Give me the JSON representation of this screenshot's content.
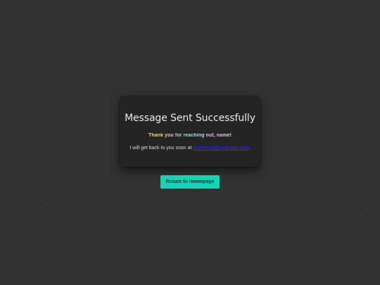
{
  "confirmation": {
    "title": "Message Sent Successfully",
    "thanks_text": "Thank you for reaching out, name!",
    "reply_prefix": "I will get back to you soon at ",
    "email_link": "youremail@example.com",
    "reply_suffix": "."
  },
  "actions": {
    "home_button_label": "Return to Homepage"
  },
  "colors": {
    "background": "#323232",
    "card": "#242424",
    "accent_button": "#12d4b8",
    "link": "#2f2ff0"
  }
}
